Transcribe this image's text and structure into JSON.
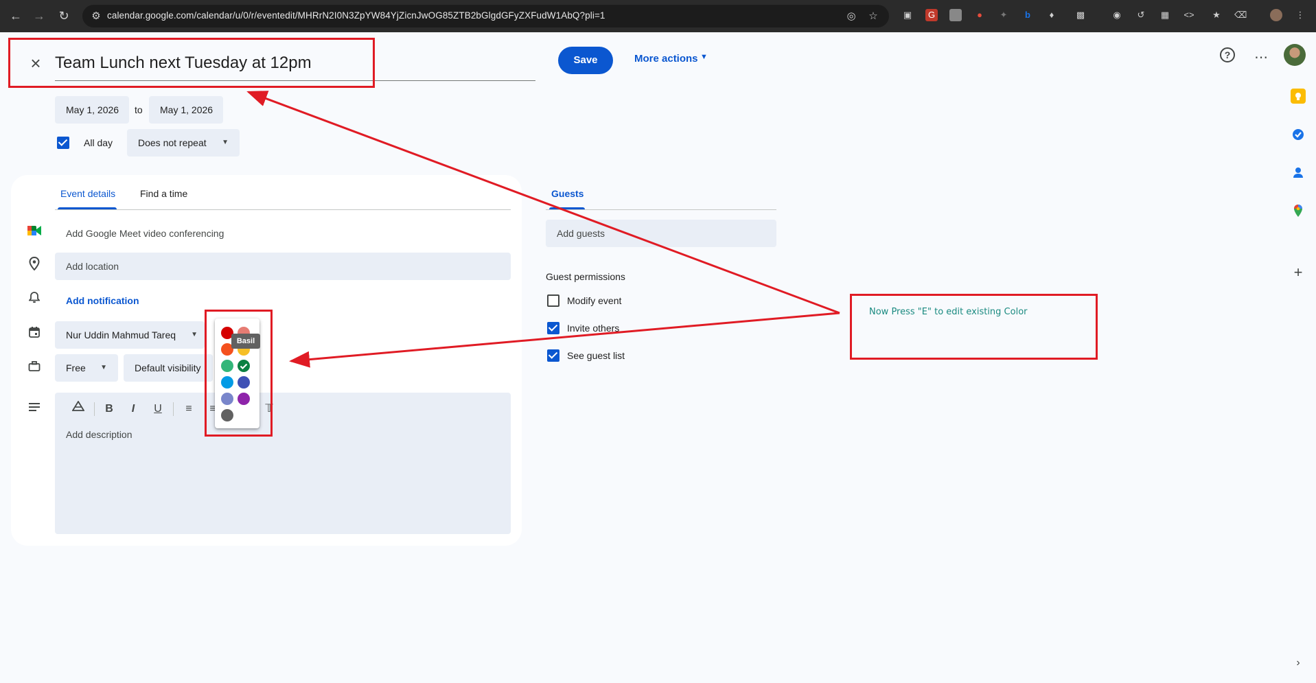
{
  "browser": {
    "url": "calendar.google.com/calendar/u/0/r/eventedit/MHRrN2I0N3ZpYW84YjZicnJwOG85ZTB2bGlgdGFyZXFudW1AbQ?pli=1"
  },
  "header": {
    "title": "Team Lunch next Tuesday at 12pm",
    "save_label": "Save",
    "more_actions_label": "More actions"
  },
  "dates": {
    "start": "May 1, 2026",
    "to_label": "to",
    "end": "May 1, 2026",
    "all_day_label": "All day",
    "all_day_checked": true,
    "repeat": "Does not repeat"
  },
  "tabs": {
    "event_details": "Event details",
    "find_time": "Find a time",
    "guests": "Guests"
  },
  "details": {
    "meet": "Add Google Meet video conferencing",
    "location_placeholder": "Add location",
    "notification": "Add notification",
    "calendar_owner": "Nur Uddin Mahmud Tareq",
    "availability": "Free",
    "visibility": "Default visibility",
    "description_placeholder": "Add description"
  },
  "color_picker": {
    "tooltip": "Basil",
    "selected": "Basil",
    "swatches": [
      "#d50000",
      "#e67c73",
      "#f4511e",
      "#f6bf26",
      "#33b679",
      "#0b8043",
      "#039be5",
      "#3f51b5",
      "#7986cb",
      "#8e24aa",
      "#616161"
    ]
  },
  "guests": {
    "add_placeholder": "Add guests",
    "permissions_title": "Guest permissions",
    "modify_event": "Modify event",
    "invite_others": "Invite others",
    "see_guest_list": "See guest list"
  },
  "annotation": {
    "note": "Now Press \"E\" to edit existing Color"
  }
}
